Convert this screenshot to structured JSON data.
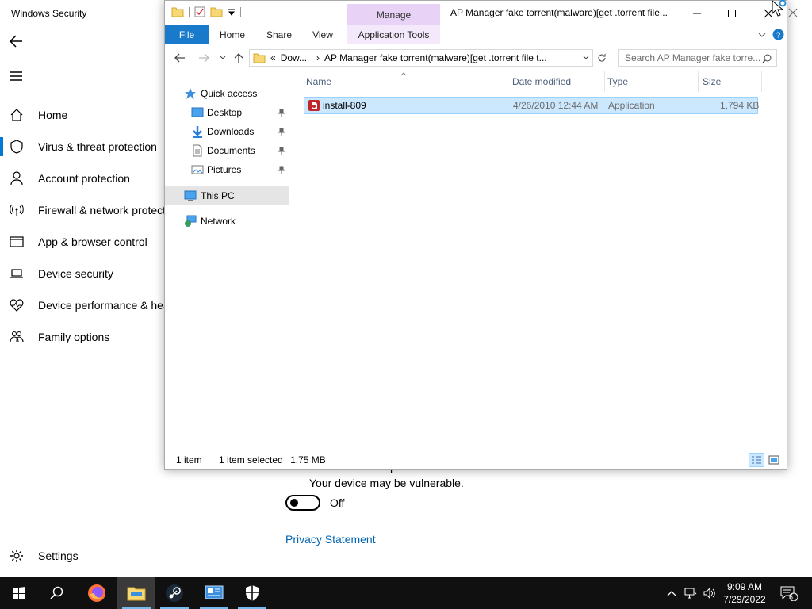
{
  "security": {
    "title": "Windows Security",
    "nav": [
      {
        "label": "Home",
        "icon": "home-icon"
      },
      {
        "label": "Virus & threat protection",
        "icon": "shield-icon"
      },
      {
        "label": "Account protection",
        "icon": "person-icon"
      },
      {
        "label": "Firewall & network protection",
        "icon": "antenna-icon"
      },
      {
        "label": "App & browser control",
        "icon": "app-window-icon"
      },
      {
        "label": "Device security",
        "icon": "laptop-icon"
      },
      {
        "label": "Device performance & health",
        "icon": "heart-icon"
      },
      {
        "label": "Family options",
        "icon": "family-icon"
      }
    ],
    "settings_label": "Settings",
    "cloud_msg_line1": "Cloud-delivered protection is off.",
    "cloud_msg_line2": "Your device may be vulnerable.",
    "toggle_label": "Off",
    "privacy_link": "Privacy Statement"
  },
  "explorer": {
    "title": "AP Manager fake torrent(malware)[get .torrent file...",
    "manage_tab": "Manage",
    "ribbon_tabs": {
      "file": "File",
      "home": "Home",
      "share": "Share",
      "view": "View",
      "app_tools": "Application Tools"
    },
    "address": {
      "overflow": "«",
      "part1": "Dow...",
      "part2": "AP Manager fake torrent(malware)[get .torrent file t..."
    },
    "search_placeholder": "Search AP Manager fake torre...",
    "tree": {
      "quick_access": "Quick access",
      "desktop": "Desktop",
      "downloads": "Downloads",
      "documents": "Documents",
      "pictures": "Pictures",
      "this_pc": "This PC",
      "network": "Network"
    },
    "columns": {
      "name": "Name",
      "date": "Date modified",
      "type": "Type",
      "size": "Size"
    },
    "files": [
      {
        "name": "install-809",
        "date": "4/26/2010 12:44 AM",
        "type": "Application",
        "size": "1,794 KB"
      }
    ],
    "status": {
      "count": "1 item",
      "selected": "1 item selected",
      "size": "1.75 MB"
    }
  },
  "taskbar": {
    "time": "9:09 AM",
    "date": "7/29/2022",
    "notification_count": "5"
  },
  "colors": {
    "accent": "#0078d4",
    "manage_tab": "#e8d2f5",
    "selection": "#cce8ff",
    "file_tab": "#1979ca"
  }
}
